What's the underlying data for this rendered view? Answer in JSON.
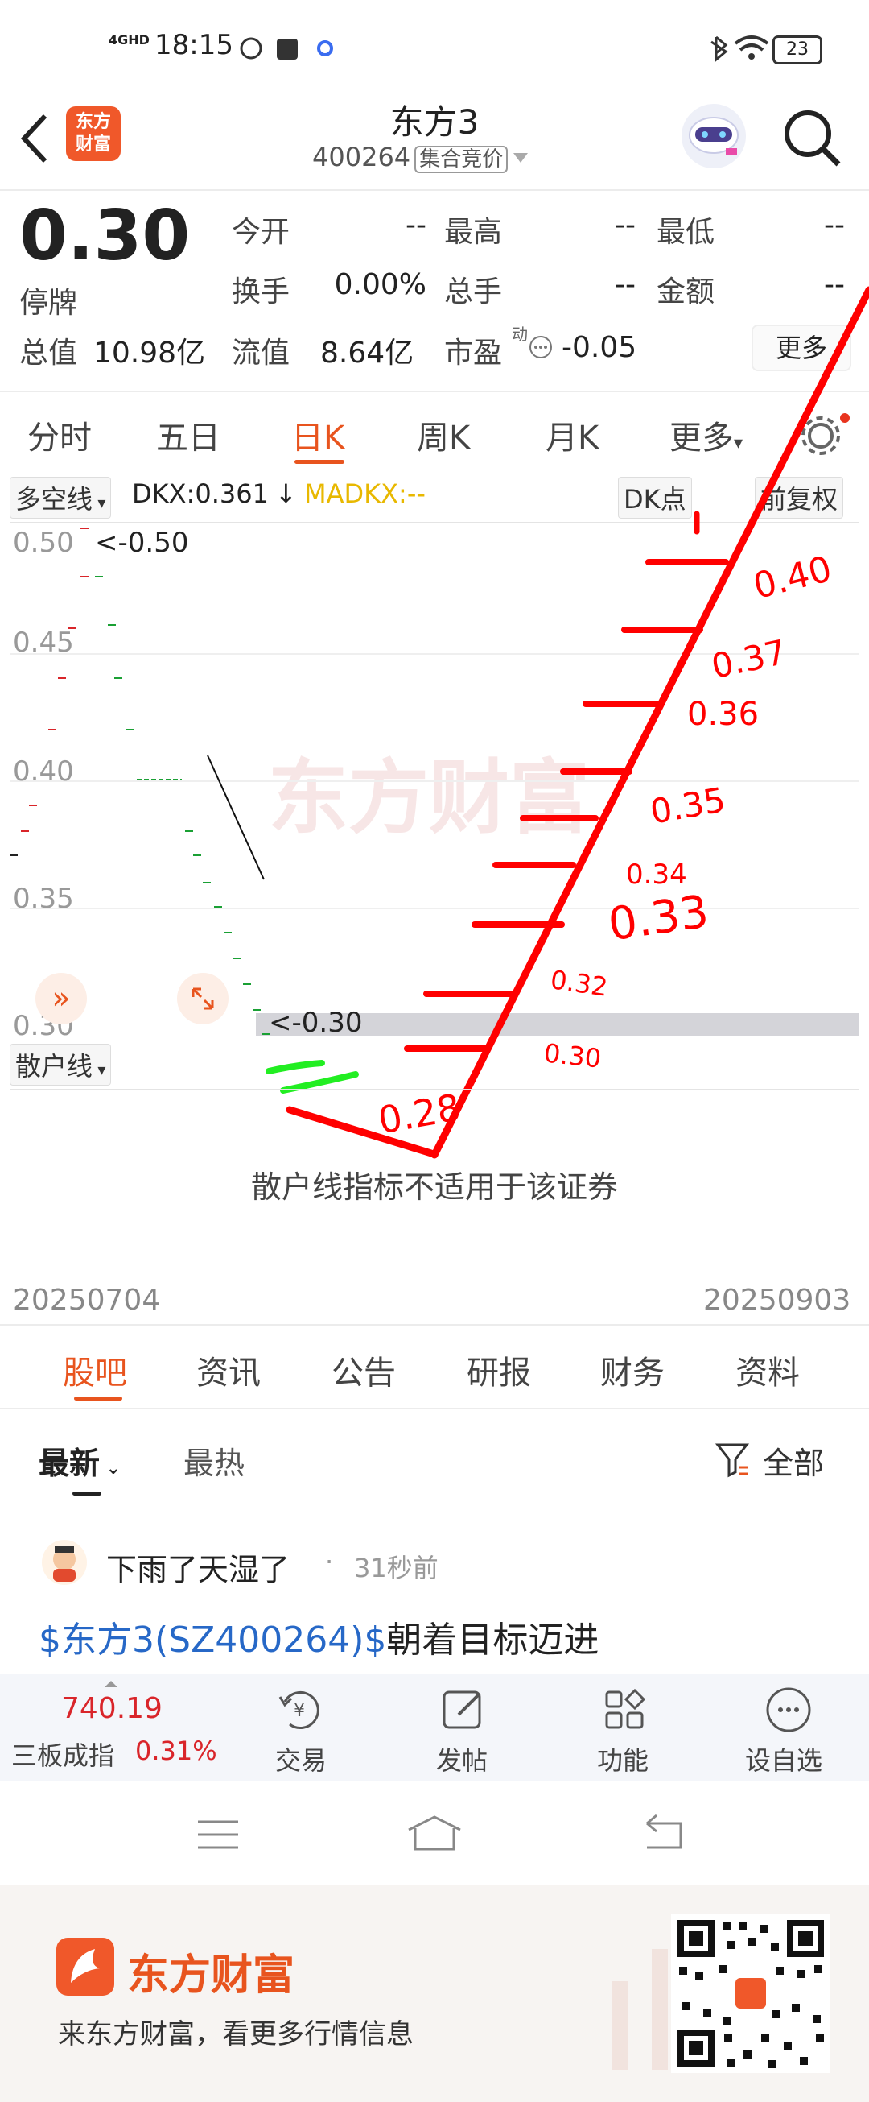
{
  "status_bar": {
    "network": "4GHD",
    "time": "18:15",
    "battery": "23"
  },
  "header": {
    "back_icon": "chevron-left-icon",
    "logo_text": "东方\n财富",
    "title": "东方3",
    "code": "400264",
    "tag": "集合竞价",
    "search_icon": "search-icon"
  },
  "quote": {
    "price": "0.30",
    "status": "停牌",
    "rows": [
      [
        {
          "label": "今开",
          "value": "--"
        },
        {
          "label": "最高",
          "value": "--"
        },
        {
          "label": "最低",
          "value": "--"
        }
      ],
      [
        {
          "label": "换手",
          "value": "0.00%"
        },
        {
          "label": "总手",
          "value": "--"
        },
        {
          "label": "金额",
          "value": "--"
        }
      ]
    ],
    "total_value_label": "总值",
    "total_value": "10.98亿",
    "float_value_label": "流值",
    "float_value": "8.64亿",
    "pe_label": "市盈",
    "pe_sup": "动",
    "pe_value": "-0.05",
    "more_button": "更多"
  },
  "chart_tabs": [
    "分时",
    "五日",
    "日K",
    "周K",
    "月K",
    "更多"
  ],
  "active_chart_tab": 2,
  "indicator_bar": {
    "selector": "多空线",
    "dkx": "DKX:0.361",
    "arrow": "↓",
    "madkx": "MADKX:--",
    "dk_point": "DK点",
    "adjust": "前复权"
  },
  "y_ticks": [
    "0.50",
    "0.45",
    "0.40",
    "0.35",
    "0.30"
  ],
  "high_marker": "<-0.50",
  "low_marker": "<-0.30",
  "sub_indicator": {
    "selector": "散户线",
    "message": "散户线指标不适用于该证券"
  },
  "date_range": {
    "start": "20250704",
    "end": "20250903"
  },
  "annotations": [
    "0.40",
    "0.37",
    "0.36",
    "0.35",
    "0.34",
    "0.33",
    "0.32",
    "0.30",
    "0.28"
  ],
  "section_tabs": [
    "股吧",
    "资讯",
    "公告",
    "研报",
    "财务",
    "资料"
  ],
  "active_section_tab": 0,
  "sort_tabs": {
    "latest": "最新",
    "hot": "最热",
    "filter": "全部"
  },
  "post": {
    "user": "下雨了天湿了",
    "time": "31秒前",
    "stock_link": "$东方3(SZ400264)$",
    "text": "朝着目标迈进"
  },
  "bottom_bar": {
    "index_value": "740.19",
    "index_name": "三板成指",
    "index_change": "0.31%",
    "items": [
      "交易",
      "发帖",
      "功能",
      "设自选"
    ]
  },
  "promo": {
    "brand": "东方财富",
    "slogan": "来东方财富，看更多行情信息"
  },
  "colors": {
    "accent": "#e8541e",
    "up": "#d9252a",
    "down": "#1aa034",
    "annotation": "#ff0000"
  }
}
